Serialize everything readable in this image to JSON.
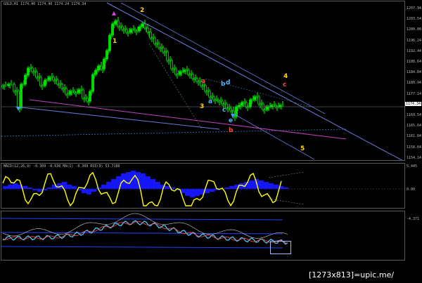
{
  "main": {
    "info": "GOLD,H1  1174.40 1174.40 1174.24 1174.34",
    "price_axis": [
      "1207.94",
      "1203.54",
      "1200.00",
      "1196.24",
      "1192.44",
      "1188.64",
      "1184.84",
      "1180.94",
      "1177.14",
      "1174.34",
      "1169.54",
      "1165.64",
      "1161.84",
      "1158.04",
      "1154.14"
    ],
    "current_price": "1174.34",
    "waves": [
      {
        "text": "2",
        "color": "#ffd700"
      },
      {
        "text": "1",
        "color": "#ffd700"
      },
      {
        "text": "a",
        "color": "#ff4d2e"
      },
      {
        "text": "b",
        "color": "#4db8ff"
      },
      {
        "text": "d",
        "color": "#4db8ff"
      },
      {
        "text": "a",
        "color": "#4db8ff"
      },
      {
        "text": "3",
        "color": "#ffd700"
      },
      {
        "text": "c",
        "color": "#4db8ff"
      },
      {
        "text": "e",
        "color": "#4db8ff"
      },
      {
        "text": "b",
        "color": "#ff4d2e"
      },
      {
        "text": "4",
        "color": "#ffd700"
      },
      {
        "text": "c",
        "color": "#ff4d2e"
      },
      {
        "text": "5",
        "color": "#ffd700"
      }
    ]
  },
  "macd": {
    "info": "MACD(12,26,9) -0.309 -0.636   MA(1) -0.309  RSI(9) 53.7180",
    "axis": [
      "5.445",
      "0.00",
      "-4.371"
    ]
  },
  "rsi": {
    "info": ""
  },
  "colors": {
    "candle": "#00e000",
    "macd_line": "#ffff00",
    "macd_fill": "#1515ff",
    "channel": "#6c7be0"
  },
  "watermark": "[1273x813]=upic.me/"
}
